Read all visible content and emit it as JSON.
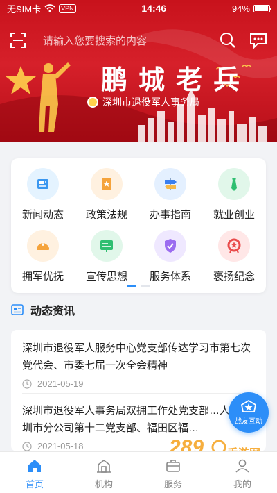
{
  "status_bar": {
    "carrier": "无SIM卡",
    "vpn": "VPN",
    "time": "14:46",
    "battery": "94%",
    "battery_level": 0.94
  },
  "header": {
    "search_placeholder": "请输入您要搜索的内容",
    "banner_title": "鹏城老兵",
    "banner_org": "深圳市退役军人事务局"
  },
  "menu": {
    "items": [
      {
        "label": "新闻动态",
        "icon": "news-icon",
        "bg": "#e4f3ff",
        "fg": "#3a97f0"
      },
      {
        "label": "政策法规",
        "icon": "policy-book-icon",
        "bg": "#fff1e0",
        "fg": "#f5a33b"
      },
      {
        "label": "办事指南",
        "icon": "guide-signpost-icon",
        "bg": "#e4f0ff",
        "fg": "#3a7ff0"
      },
      {
        "label": "就业创业",
        "icon": "tie-icon",
        "bg": "#e1f7ea",
        "fg": "#2fbf71"
      },
      {
        "label": "拥军优抚",
        "icon": "soldier-cap-icon",
        "bg": "#fff1e0",
        "fg": "#f5a33b"
      },
      {
        "label": "宣传思想",
        "icon": "board-icon",
        "bg": "#e1f7ea",
        "fg": "#2fbf71"
      },
      {
        "label": "服务体系",
        "icon": "shield-check-icon",
        "bg": "#efe8ff",
        "fg": "#9b6cf0"
      },
      {
        "label": "褒扬纪念",
        "icon": "memorial-wreath-icon",
        "bg": "#ffe7e7",
        "fg": "#e94b4b"
      }
    ],
    "page_count": 2,
    "active_page": 0
  },
  "news": {
    "section_title": "动态资讯",
    "items": [
      {
        "title": "深圳市退役军人服务中心党支部传达学习市第七次党代会、市委七届一次全会精神",
        "date": "2021-05-19"
      },
      {
        "title": "深圳市退役军人事务局双拥工作处党支部…人寿深圳市分公司第十二党支部、福田区福…",
        "date": "2021-05-18"
      }
    ]
  },
  "float_button": {
    "label": "战友互动"
  },
  "watermark": {
    "number": "289",
    "text": "手游网"
  },
  "bottom_nav": {
    "items": [
      {
        "label": "首页",
        "icon": "home-icon",
        "active": true
      },
      {
        "label": "机构",
        "icon": "building-icon",
        "active": false
      },
      {
        "label": "服务",
        "icon": "briefcase-icon",
        "active": false
      },
      {
        "label": "我的",
        "icon": "user-icon",
        "active": false
      }
    ]
  },
  "colors": {
    "brand_red": "#d6202a",
    "accent_blue": "#2c8ef8"
  }
}
